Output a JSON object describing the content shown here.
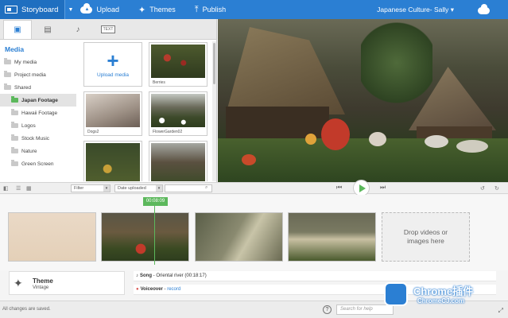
{
  "topbar": {
    "brand": "Storyboard",
    "nav": [
      {
        "label": "Upload",
        "icon": "cloud-upload-icon"
      },
      {
        "label": "Themes",
        "icon": "magic-wand-icon"
      },
      {
        "label": "Publish",
        "icon": "publish-upload-icon"
      }
    ],
    "project_title": "Japanese Culture- Sally ▾"
  },
  "media_panel": {
    "title": "Media",
    "tabs": [
      "photo-video-icon",
      "film-icon",
      "music-note-icon",
      "text-icon"
    ],
    "tab_text": "TEXT",
    "tree": [
      {
        "label": "My media",
        "indent": false,
        "active": false
      },
      {
        "label": "Project media",
        "indent": false,
        "active": false
      },
      {
        "label": "Shared",
        "indent": false,
        "active": false
      },
      {
        "label": "Japan Footage",
        "indent": true,
        "active": true
      },
      {
        "label": "Hawaii Footage",
        "indent": true,
        "active": false
      },
      {
        "label": "Logos",
        "indent": true,
        "active": false
      },
      {
        "label": "Stock Music",
        "indent": true,
        "active": false
      },
      {
        "label": "Nature",
        "indent": true,
        "active": false
      },
      {
        "label": "Green Screen",
        "indent": true,
        "active": false
      }
    ],
    "upload_label": "Upload media",
    "captions": [
      "Berries",
      "Dogs2",
      "FlowerGarden02"
    ]
  },
  "toolbar": {
    "filter": "Filter",
    "sort": "Date uploaded"
  },
  "timeline": {
    "playhead_time": "00:08:09",
    "drop_text_1": "Drop videos or",
    "drop_text_2": "images here"
  },
  "theme": {
    "label": "Theme",
    "value": "Vintage"
  },
  "audio": {
    "song_label": "Song",
    "song_value": " - Oriental river (00:18:17)",
    "voiceover_label": "Voiceover",
    "voiceover_sep": " - ",
    "voiceover_link": "record"
  },
  "status": {
    "saved": "All changes are saved.",
    "search_placeholder": "Search for help"
  },
  "watermark": {
    "line1": "Chrome插件",
    "line2": "ChromeCJ.com"
  },
  "colors": {
    "accent": "#2b7fd3",
    "play": "#5cb85c"
  }
}
